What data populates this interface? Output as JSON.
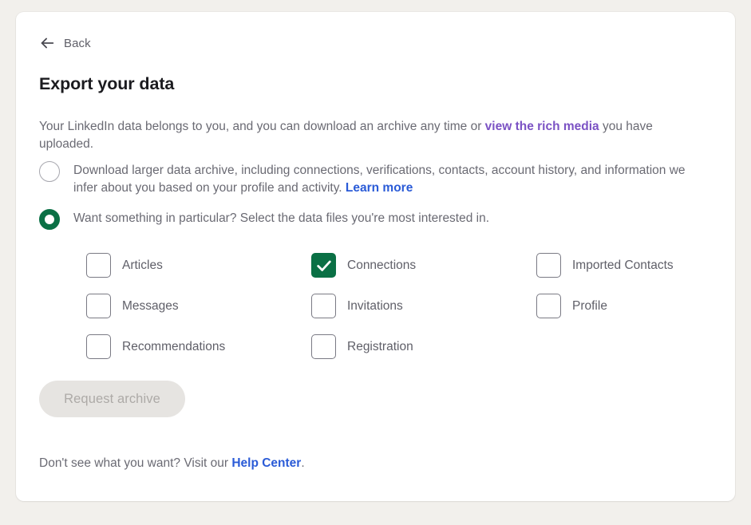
{
  "page": {
    "back_label": "Back",
    "title": "Export your data",
    "intro": {
      "before_link": "Your LinkedIn data belongs to you, and you can download an archive any time or ",
      "link_text": "view the rich media",
      "after_link": " you have uploaded."
    }
  },
  "options": [
    {
      "id": "full-archive",
      "selected": false,
      "before_link": "Download larger data archive, including connections, verifications, contacts, account history, and information we infer about you based on your profile and activity. ",
      "link_text": "Learn more",
      "after_link": ""
    },
    {
      "id": "specific-files",
      "selected": true,
      "before_link": "Want something in particular? Select the data files you're most interested in.",
      "link_text": "",
      "after_link": ""
    }
  ],
  "data_files": [
    {
      "label": "Articles",
      "checked": false
    },
    {
      "label": "Connections",
      "checked": true
    },
    {
      "label": "Imported Contacts",
      "checked": false
    },
    {
      "label": "Messages",
      "checked": false
    },
    {
      "label": "Invitations",
      "checked": false
    },
    {
      "label": "Profile",
      "checked": false
    },
    {
      "label": "Recommendations",
      "checked": false
    },
    {
      "label": "Registration",
      "checked": false
    }
  ],
  "actions": {
    "request_archive_label": "Request archive",
    "request_archive_disabled": true
  },
  "footer": {
    "before_link": "Don't see what you want? Visit our ",
    "link_text": "Help Center",
    "after_link": "."
  },
  "colors": {
    "page_background": "#f2f0ec",
    "card_background": "#ffffff",
    "accent_green": "#0a7045",
    "link_blue": "#2a5bd7",
    "link_purple": "#7b52c4",
    "text_muted": "#6a6a73",
    "disabled_button_bg": "#e6e4e1",
    "disabled_button_text": "#adaaa7"
  }
}
